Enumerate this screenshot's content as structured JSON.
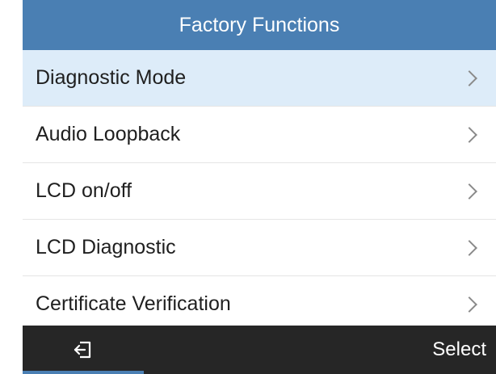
{
  "header": {
    "title": "Factory Functions"
  },
  "menu": {
    "items": [
      {
        "label": "Diagnostic Mode"
      },
      {
        "label": "Audio Loopback"
      },
      {
        "label": "LCD on/off"
      },
      {
        "label": "LCD Diagnostic"
      },
      {
        "label": "Certificate Verification"
      }
    ]
  },
  "softkeys": {
    "right": "Select",
    "left_icon": "back-icon"
  },
  "colors": {
    "title_bar": "#4a7fb3",
    "selected_row": "#ddecf9",
    "softbar": "#262626"
  }
}
